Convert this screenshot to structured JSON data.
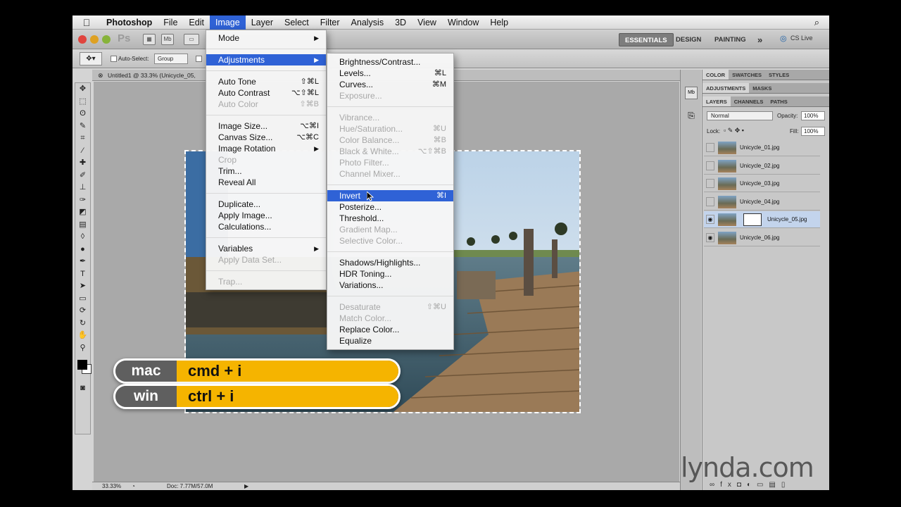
{
  "menubar": {
    "apple": "",
    "items": [
      "Photoshop",
      "File",
      "Edit",
      "Image",
      "Layer",
      "Select",
      "Filter",
      "Analysis",
      "3D",
      "View",
      "Window",
      "Help"
    ],
    "search_icon": "⌕"
  },
  "appbar": {
    "ps_logo": "Ps",
    "mb": "Mb",
    "workspaces": [
      "ESSENTIALS",
      "DESIGN",
      "PAINTING"
    ],
    "more": "»",
    "cs_live": "CS Live"
  },
  "optbar": {
    "auto_select": "Auto-Select:",
    "group": "Group"
  },
  "document_tab": "Untitled1 @ 33.3% (Unicycle_05,",
  "status": {
    "zoom": "33.33%",
    "doc": "Doc: 7.77M/57.0M"
  },
  "image_menu": [
    {
      "label": "Mode",
      "submenu": true
    },
    {
      "sep": true
    },
    {
      "label": "Adjustments",
      "submenu": true,
      "highlight": true
    },
    {
      "sep": true
    },
    {
      "label": "Auto Tone",
      "shortcut": "⇧⌘L"
    },
    {
      "label": "Auto Contrast",
      "shortcut": "⌥⇧⌘L"
    },
    {
      "label": "Auto Color",
      "shortcut": "⇧⌘B",
      "disabled": true
    },
    {
      "sep": true
    },
    {
      "label": "Image Size...",
      "shortcut": "⌥⌘I"
    },
    {
      "label": "Canvas Size...",
      "shortcut": "⌥⌘C"
    },
    {
      "label": "Image Rotation",
      "submenu": true
    },
    {
      "label": "Crop",
      "disabled": true
    },
    {
      "label": "Trim..."
    },
    {
      "label": "Reveal All"
    },
    {
      "sep": true
    },
    {
      "label": "Duplicate..."
    },
    {
      "label": "Apply Image..."
    },
    {
      "label": "Calculations..."
    },
    {
      "sep": true
    },
    {
      "label": "Variables",
      "submenu": true
    },
    {
      "label": "Apply Data Set...",
      "disabled": true
    },
    {
      "sep": true
    },
    {
      "label": "Trap...",
      "disabled": true
    }
  ],
  "adjustments_menu": [
    {
      "label": "Brightness/Contrast..."
    },
    {
      "label": "Levels...",
      "shortcut": "⌘L"
    },
    {
      "label": "Curves...",
      "shortcut": "⌘M"
    },
    {
      "label": "Exposure...",
      "disabled": true
    },
    {
      "sep": true
    },
    {
      "label": "Vibrance...",
      "disabled": true
    },
    {
      "label": "Hue/Saturation...",
      "shortcut": "⌘U",
      "disabled": true
    },
    {
      "label": "Color Balance...",
      "shortcut": "⌘B",
      "disabled": true
    },
    {
      "label": "Black & White...",
      "shortcut": "⌥⇧⌘B",
      "disabled": true
    },
    {
      "label": "Photo Filter...",
      "disabled": true
    },
    {
      "label": "Channel Mixer...",
      "disabled": true
    },
    {
      "sep": true
    },
    {
      "label": "Invert",
      "shortcut": "⌘I",
      "highlight": true
    },
    {
      "label": "Posterize..."
    },
    {
      "label": "Threshold..."
    },
    {
      "label": "Gradient Map...",
      "disabled": true
    },
    {
      "label": "Selective Color...",
      "disabled": true
    },
    {
      "sep": true
    },
    {
      "label": "Shadows/Highlights..."
    },
    {
      "label": "HDR Toning..."
    },
    {
      "label": "Variations..."
    },
    {
      "sep": true
    },
    {
      "label": "Desaturate",
      "shortcut": "⇧⌘U",
      "disabled": true
    },
    {
      "label": "Match Color...",
      "disabled": true
    },
    {
      "label": "Replace Color..."
    },
    {
      "label": "Equalize"
    }
  ],
  "panels": {
    "row1": [
      "COLOR",
      "SWATCHES",
      "STYLES"
    ],
    "row2": [
      "ADJUSTMENTS",
      "MASKS"
    ],
    "row3": [
      "LAYERS",
      "CHANNELS",
      "PATHS"
    ],
    "blend_mode": "Normal",
    "opacity_label": "Opacity:",
    "opacity": "100%",
    "lock_label": "Lock:",
    "fill_label": "Fill:",
    "fill": "100%",
    "layers": [
      {
        "name": "Unicycle_01.jpg",
        "visible": false,
        "selected": false
      },
      {
        "name": "Unicycle_02.jpg",
        "visible": false,
        "selected": false
      },
      {
        "name": "Unicycle_03.jpg",
        "visible": false,
        "selected": false
      },
      {
        "name": "Unicycle_04.jpg",
        "visible": false,
        "selected": false
      },
      {
        "name": "Unicycle_05.jpg",
        "visible": true,
        "selected": true
      },
      {
        "name": "Unicycle_06.jpg",
        "visible": true,
        "selected": false
      }
    ]
  },
  "shortcuts": [
    {
      "os": "mac",
      "keys": "cmd + i"
    },
    {
      "os": "win",
      "keys": "ctrl + i"
    }
  ],
  "watermark": "lynda.com",
  "colors": {
    "highlight": "#2f62d6",
    "pill": "#f5b400"
  }
}
